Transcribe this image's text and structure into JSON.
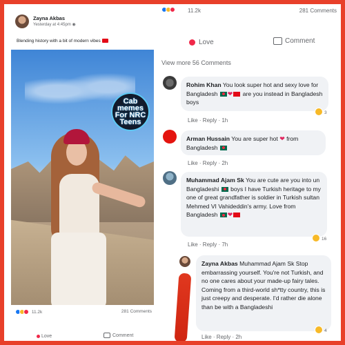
{
  "left_post": {
    "author": "Zayna Akbas",
    "time": "Yesterday at 4:45pm",
    "caption": "Blending history with a bit of modern vibes",
    "badge_text": "Cab memes For NRC Teens",
    "reactions_count": "11.2k",
    "comments_count": "281 Comments",
    "love_label": "Love",
    "comment_label": "Comment"
  },
  "right_panel": {
    "top_reactions_count": "11.2k",
    "top_comments_count": "281 Comments",
    "love_label": "Love",
    "comment_label": "Comment",
    "view_more": "View more 56 Comments",
    "comments": [
      {
        "author": "Rohim Khan",
        "text_part1": "You look super hot and sexy love for Bangladesh",
        "text_part2": "are you instead in Bangladesh boys",
        "meta": "Like · Reply · 1h",
        "reactions": "3"
      },
      {
        "author": "Arman Hussain",
        "text_part1": "You are super hot",
        "text_part2": "from Bangladesh",
        "meta": "Like · Reply · 2h"
      },
      {
        "author": "Muhammad Ajam Sk",
        "text": "You are cute are you into un Bangladeshi",
        "text2": "boys I have Turkish heritage to my one of great grandfather is soldier in Turkish sultan Mehmed VI Vahideddin's army. Love from Bangladesh",
        "meta": "Like · Reply · 7h",
        "reactions": "16"
      },
      {
        "author": "Zayna Akbas",
        "text": "Muhammad Ajam Sk Stop embarrassing yourself. You're not Turkish, and no one cares about your made-up fairy tales. Coming from a third-world sh*tty country, this is just creepy and desperate. I'd rather die alone than be with a Bangladeshi",
        "meta": "Like · Reply · 2h",
        "reactions": "4"
      }
    ]
  },
  "colors": {
    "frame": "#e8402a",
    "love": "#f02849",
    "bubble": "#f0f2f5"
  }
}
